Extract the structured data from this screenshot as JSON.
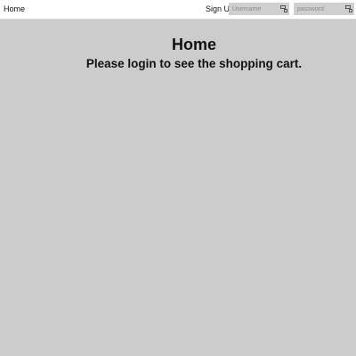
{
  "nav": {
    "home_label": "Home",
    "signup_label": "Sign Up"
  },
  "login": {
    "username_placeholder": "Username",
    "password_placeholder": "password"
  },
  "main": {
    "title": "Home",
    "message": "Please login to see the shopping cart."
  },
  "icons": {
    "field_icon": "key-icon"
  },
  "colors": {
    "page_background": "#cccccc",
    "topbar_background": "#ffffff",
    "field_background": "#cfcfcf",
    "text": "#111111"
  }
}
